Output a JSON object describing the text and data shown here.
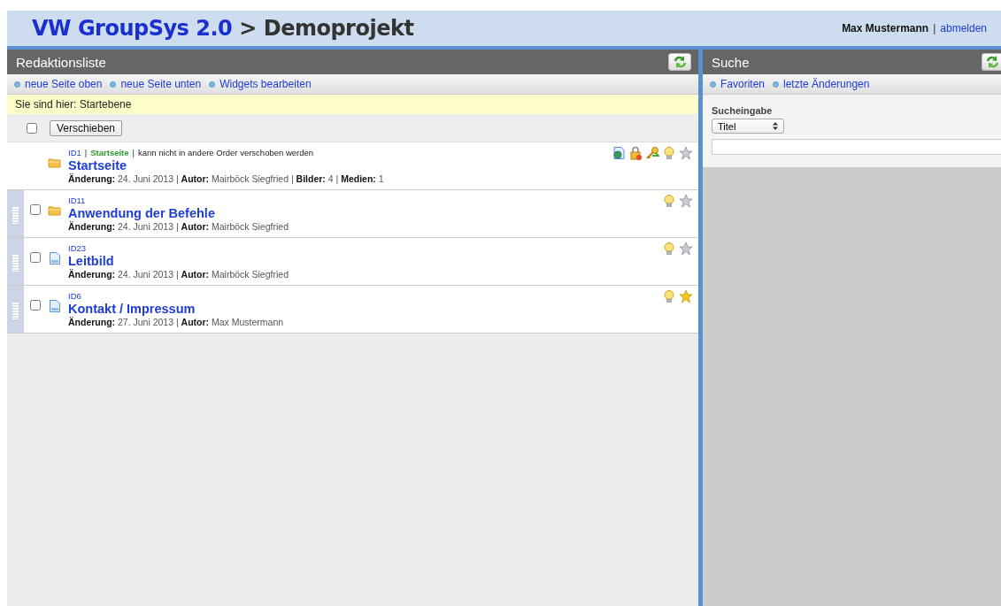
{
  "header": {
    "brand": "VW GroupSys 2.0",
    "separator": ">",
    "project": "Demoprojekt",
    "user": "Max Mustermann",
    "user_separator": "|",
    "logout": "abmelden"
  },
  "editorial": {
    "title": "Redaktionsliste",
    "links": [
      "neue Seite oben",
      "neue Seite unten",
      "Widgets bearbeiten"
    ],
    "breadcrumb": "Sie sind hier: Startebene",
    "select_all": {
      "checked": false
    },
    "move_button": "Verschieben",
    "rows": [
      {
        "kind": "start",
        "id": "ID1",
        "separator": "|",
        "tag": "Startseite",
        "note": "kann nicht in andere Order verschoben werden",
        "title": "Startseite",
        "meta": "**Änderung:** 24. Juni 2013 | **Autor:** Mairböck Siegfried | **Bilder:** 4 | **Medien:** 1",
        "favorite": false
      },
      {
        "kind": "folder",
        "id": "ID11",
        "title": "Anwendung der Befehle",
        "meta": "**Änderung:** 24. Juni 2013 | **Autor:** Mairböck Siegfried",
        "checked": false,
        "favorite": false
      },
      {
        "kind": "page",
        "id": "ID23",
        "title": "Leitbild",
        "meta": "**Änderung:** 24. Juni 2013 | **Autor:** Mairböck Siegfried",
        "checked": false,
        "favorite": false
      },
      {
        "kind": "page",
        "id": "ID6",
        "title": "Kontakt / Impressum",
        "meta": "**Änderung:** 27. Juni 2013 | **Autor:** Max Mustermann",
        "checked": false,
        "favorite": true
      }
    ]
  },
  "search": {
    "title": "Suche",
    "links": [
      "Favoriten",
      "letzte Änderungen"
    ],
    "label": "Sucheingabe",
    "field_select": "Titel"
  }
}
